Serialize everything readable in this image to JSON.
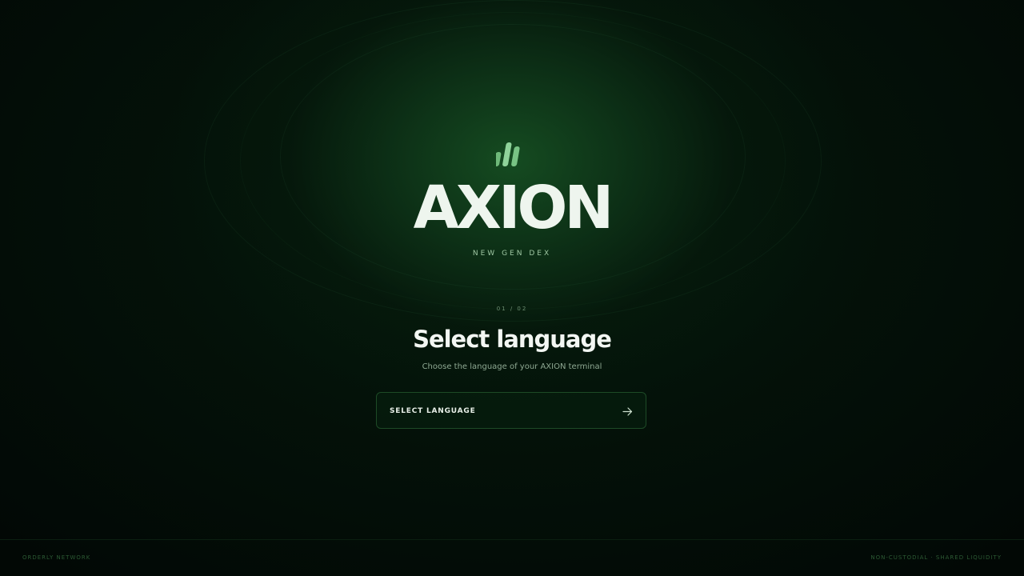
{
  "brand": {
    "name": "AXION",
    "tagline": "NEW GEN DEX",
    "logo_icon": "bar-chart-icon",
    "accent_color": "#7fc98a"
  },
  "onboarding": {
    "step": "01 / 02",
    "title": "Select language",
    "subtitle": "Choose the language of your AXION terminal",
    "select": {
      "label": "SELECT LANGUAGE",
      "icon": "arrow-right-icon"
    }
  },
  "footer": {
    "left": "ORDERLY NETWORK",
    "right": "NON-CUSTODIAL · SHARED LIQUIDITY"
  }
}
